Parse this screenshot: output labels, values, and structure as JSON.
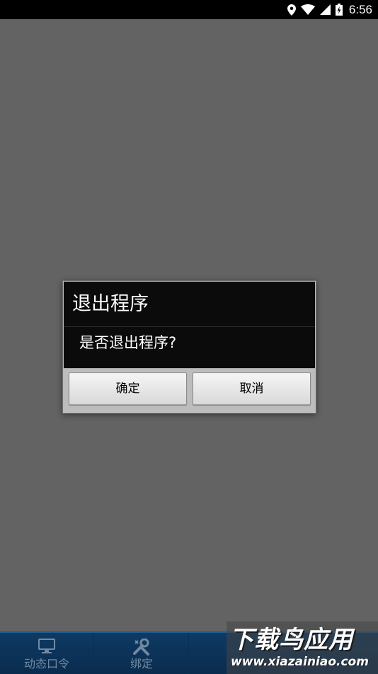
{
  "status_bar": {
    "time": "6:56",
    "icons": [
      "location-icon",
      "wifi-icon",
      "cell-signal-icon",
      "battery-charging-icon"
    ]
  },
  "dialog": {
    "title": "退出程序",
    "message": "是否退出程序?",
    "confirm_label": "确定",
    "cancel_label": "取消"
  },
  "bottom_nav": {
    "items": [
      {
        "label": "动态口令",
        "icon": "monitor-icon"
      },
      {
        "label": "绑定",
        "icon": "tools-icon"
      }
    ]
  },
  "watermark": {
    "title": "下载鸟应用",
    "url": "www.xiazainiao.com"
  },
  "colors": {
    "status_bar": "#000000",
    "background": "#636363",
    "dialog_body": "#0b0b0b",
    "dialog_frame": "#bcbcbc",
    "nav_bar": "#0e3a63",
    "nav_text": "#6f8aa3"
  }
}
